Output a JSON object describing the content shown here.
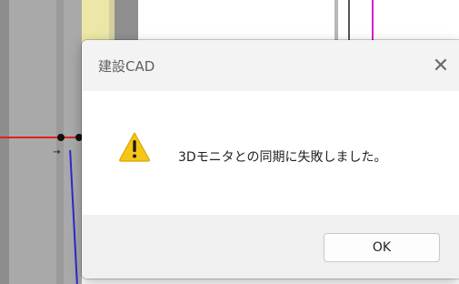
{
  "dialog": {
    "title": "建設CAD",
    "message": "3Dモニタとの同期に失敗しました。",
    "ok_label": "OK",
    "close_glyph": "✕",
    "icon": "warning-icon"
  },
  "colors": {
    "warning_fill": "#f5c518",
    "warning_stroke": "#d9a400",
    "titlebar_bg": "#f3f3f3",
    "footer_bg": "#f0f0f0"
  }
}
